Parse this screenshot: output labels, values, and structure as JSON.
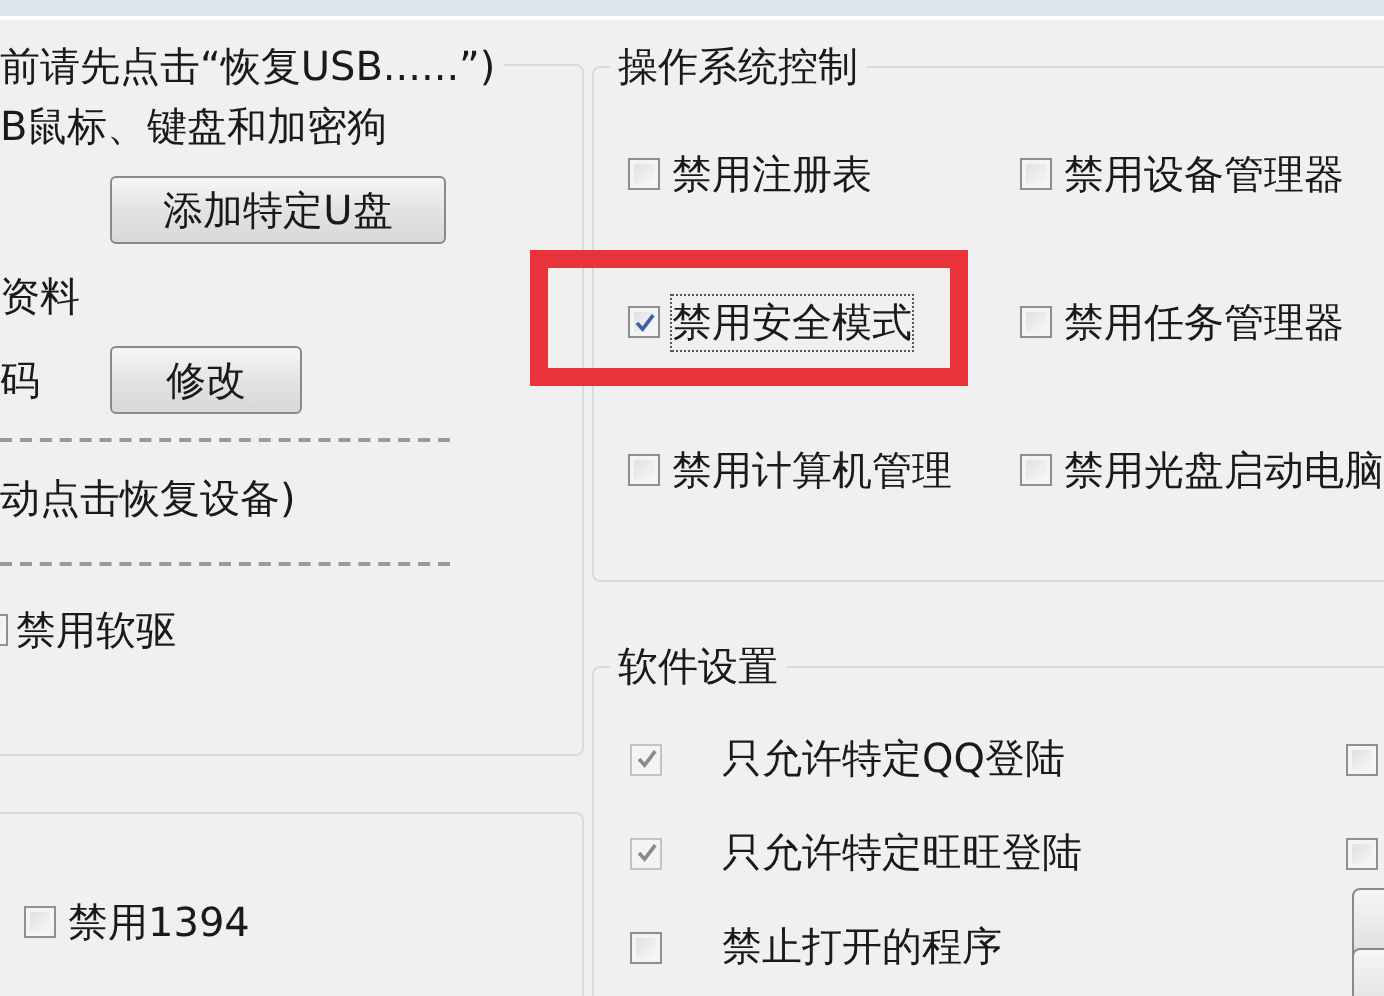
{
  "usb_group": {
    "notice": "前请先点击“恢复USB......”)",
    "devices_label": "B鼠标、键盘和加密狗",
    "add_button": "添加特定U盘",
    "profile_label": "资料",
    "password_label": "码",
    "modify_button": "修改",
    "restore_hint": "动点击恢复设备)",
    "floppy": {
      "label": "禁用软驱",
      "checked": false
    }
  },
  "port_group": {
    "items": [
      {
        "label": "禁用1394",
        "checked": false
      }
    ]
  },
  "os_control": {
    "title": "操作系统控制",
    "options": [
      {
        "label": "禁用注册表",
        "checked": false,
        "highlighted": false
      },
      {
        "label": "禁用设备管理器",
        "checked": false,
        "highlighted": false
      },
      {
        "label": "禁用安全模式",
        "checked": true,
        "highlighted": true
      },
      {
        "label": "禁用任务管理器",
        "checked": false,
        "highlighted": false
      },
      {
        "label": "禁用计算机管理",
        "checked": false,
        "highlighted": false
      },
      {
        "label": "禁用光盘启动电脑",
        "checked": false,
        "highlighted": false
      }
    ]
  },
  "software_settings": {
    "title": "软件设置",
    "options": [
      {
        "label": "只允许特定QQ登陆",
        "checked": true,
        "disabled": true
      },
      {
        "label": "只允许特定旺旺登陆",
        "checked": true,
        "disabled": true
      },
      {
        "label": "禁止打开的程序",
        "checked": false,
        "disabled": false
      }
    ],
    "side_checkboxes": [
      {
        "checked": false
      },
      {
        "checked": false
      }
    ]
  }
}
